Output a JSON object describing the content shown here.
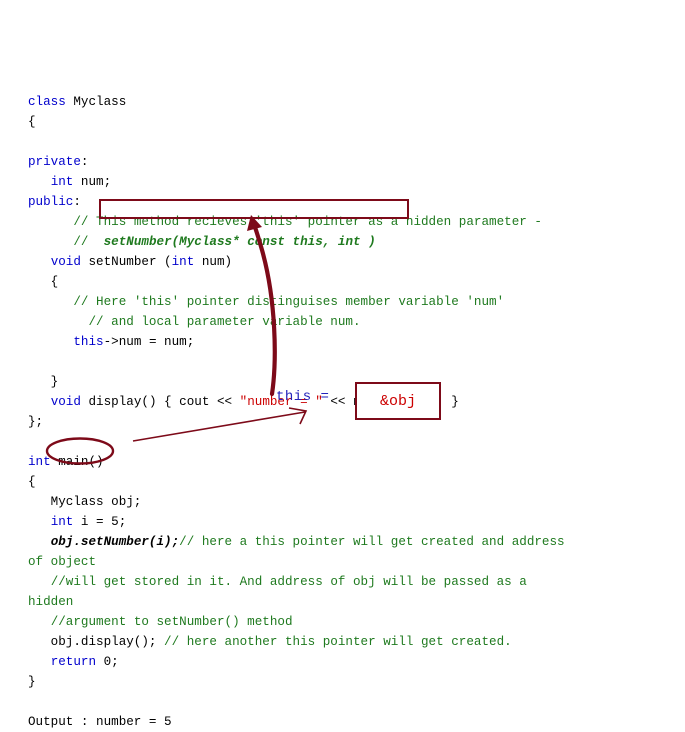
{
  "document": {
    "kind": "annotated-c++-code-snippet",
    "language": "C++",
    "topic": "this pointer"
  },
  "code_lines": [
    {
      "indent": 0,
      "tokens": [
        {
          "t": "kw",
          "v": "class"
        },
        {
          "t": "plain",
          "v": " Myclass"
        }
      ]
    },
    {
      "indent": 0,
      "tokens": [
        {
          "t": "plain",
          "v": "{"
        }
      ]
    },
    {
      "indent": 0,
      "tokens": [
        {
          "t": "plain",
          "v": ""
        }
      ]
    },
    {
      "indent": 0,
      "tokens": [
        {
          "t": "kw",
          "v": "private"
        },
        {
          "t": "plain",
          "v": ":"
        }
      ]
    },
    {
      "indent": 0,
      "tokens": [
        {
          "t": "plain",
          "v": "   "
        },
        {
          "t": "kw",
          "v": "int"
        },
        {
          "t": "plain",
          "v": " num;"
        }
      ]
    },
    {
      "indent": 0,
      "tokens": [
        {
          "t": "kw",
          "v": "public"
        },
        {
          "t": "plain",
          "v": ":"
        }
      ]
    },
    {
      "indent": 0,
      "tokens": [
        {
          "t": "plain",
          "v": "      "
        },
        {
          "t": "cmt",
          "v": "// This method recieves 'this' pointer as a hidden parameter -"
        }
      ]
    },
    {
      "indent": 0,
      "tokens": [
        {
          "t": "plain",
          "v": "      "
        },
        {
          "t": "cmt",
          "v": "// "
        },
        {
          "t": "cmt-ital",
          "v": " setNumber(Myclass* const this, int )"
        }
      ]
    },
    {
      "indent": 0,
      "tokens": [
        {
          "t": "plain",
          "v": "   "
        },
        {
          "t": "kw",
          "v": "void"
        },
        {
          "t": "plain",
          "v": " setNumber ("
        },
        {
          "t": "kw",
          "v": "int"
        },
        {
          "t": "plain",
          "v": " num)"
        }
      ]
    },
    {
      "indent": 0,
      "tokens": [
        {
          "t": "plain",
          "v": "   {"
        }
      ]
    },
    {
      "indent": 0,
      "tokens": [
        {
          "t": "plain",
          "v": "      "
        },
        {
          "t": "cmt",
          "v": "// Here 'this' pointer distinguises member variable 'num'"
        }
      ]
    },
    {
      "indent": 0,
      "tokens": [
        {
          "t": "plain",
          "v": "        "
        },
        {
          "t": "cmt",
          "v": "// and local parameter variable num."
        }
      ]
    },
    {
      "indent": 0,
      "tokens": [
        {
          "t": "plain",
          "v": "      "
        },
        {
          "t": "kw",
          "v": "this"
        },
        {
          "t": "plain",
          "v": "->num = num;"
        }
      ]
    },
    {
      "indent": 0,
      "tokens": [
        {
          "t": "plain",
          "v": ""
        }
      ]
    },
    {
      "indent": 0,
      "tokens": [
        {
          "t": "plain",
          "v": "   }"
        }
      ]
    },
    {
      "indent": 0,
      "tokens": [
        {
          "t": "plain",
          "v": "   "
        },
        {
          "t": "kw",
          "v": "void"
        },
        {
          "t": "plain",
          "v": " display() { cout << "
        },
        {
          "t": "str",
          "v": "\"number = \""
        },
        {
          "t": "plain",
          "v": " << num << "
        },
        {
          "t": "str",
          "v": "\"\\n\""
        },
        {
          "t": "plain",
          "v": "; }"
        }
      ]
    },
    {
      "indent": 0,
      "tokens": [
        {
          "t": "plain",
          "v": "};"
        }
      ]
    },
    {
      "indent": 0,
      "tokens": [
        {
          "t": "plain",
          "v": ""
        }
      ]
    },
    {
      "indent": 0,
      "tokens": [
        {
          "t": "kw",
          "v": "int"
        },
        {
          "t": "plain",
          "v": " main()"
        }
      ]
    },
    {
      "indent": 0,
      "tokens": [
        {
          "t": "plain",
          "v": "{"
        }
      ]
    },
    {
      "indent": 0,
      "tokens": [
        {
          "t": "plain",
          "v": "   Myclass obj;"
        }
      ]
    },
    {
      "indent": 0,
      "tokens": [
        {
          "t": "plain",
          "v": "   "
        },
        {
          "t": "kw",
          "v": "int"
        },
        {
          "t": "plain",
          "v": " i = 5;"
        }
      ]
    },
    {
      "indent": 0,
      "tokens": [
        {
          "t": "plain",
          "v": "   "
        },
        {
          "t": "ital",
          "v": "obj.setNumber(i);"
        },
        {
          "t": "cmt",
          "v": "// here a this pointer will get created and address"
        }
      ]
    },
    {
      "indent": 0,
      "tokens": [
        {
          "t": "cmt",
          "v": "of object"
        }
      ]
    },
    {
      "indent": 0,
      "tokens": [
        {
          "t": "plain",
          "v": "   "
        },
        {
          "t": "cmt",
          "v": "//will get stored in it. And address of obj will be passed as a"
        }
      ]
    },
    {
      "indent": 0,
      "tokens": [
        {
          "t": "cmt",
          "v": "hidden"
        }
      ]
    },
    {
      "indent": 0,
      "tokens": [
        {
          "t": "plain",
          "v": "   "
        },
        {
          "t": "cmt",
          "v": "//argument to setNumber() method"
        }
      ]
    },
    {
      "indent": 0,
      "tokens": [
        {
          "t": "plain",
          "v": "   obj.display(); "
        },
        {
          "t": "cmt",
          "v": "// here another this pointer will get created."
        }
      ]
    },
    {
      "indent": 0,
      "tokens": [
        {
          "t": "plain",
          "v": "   "
        },
        {
          "t": "kw",
          "v": "return"
        },
        {
          "t": "plain",
          "v": " 0;"
        }
      ]
    },
    {
      "indent": 0,
      "tokens": [
        {
          "t": "plain",
          "v": "}"
        }
      ]
    },
    {
      "indent": 0,
      "tokens": [
        {
          "t": "plain",
          "v": ""
        }
      ]
    },
    {
      "indent": 0,
      "tokens": [
        {
          "t": "plain",
          "v": "Output : number = 5"
        }
      ]
    }
  ],
  "annotations": {
    "this_label": "this =",
    "obj_value": "&obj",
    "boxed_comment_text": "setNumber(Myclass* const this, int )",
    "circled_token": "obj.",
    "curved_arrow_name": "hidden-parameter-arrow",
    "thin_arrow_name": "object-address-arrow"
  },
  "colors": {
    "keyword": "#0000cc",
    "comment": "#1f7a1f",
    "string": "#cc0000",
    "plain": "#000000",
    "annotation_red": "#7d0a19",
    "value_red": "#cc0000",
    "this_blue": "#2222bb",
    "background": "#ffffff"
  }
}
